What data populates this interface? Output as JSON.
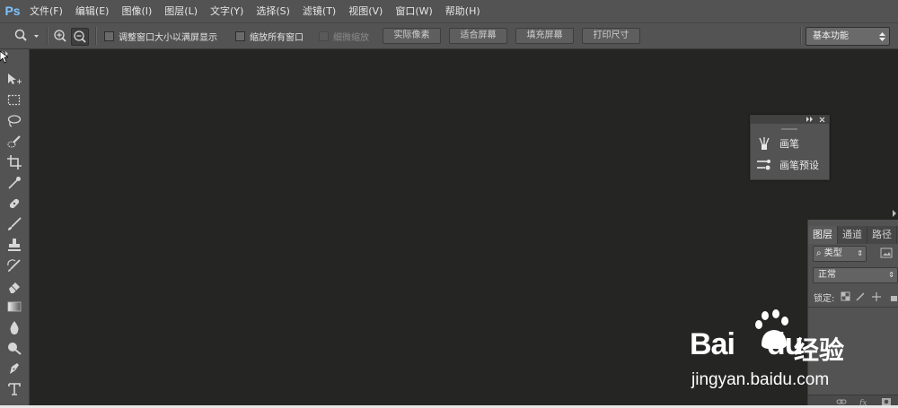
{
  "app": {
    "logo_text": "Ps"
  },
  "menu": [
    {
      "label": "文件(F)"
    },
    {
      "label": "编辑(E)"
    },
    {
      "label": "图像(I)"
    },
    {
      "label": "图层(L)"
    },
    {
      "label": "文字(Y)"
    },
    {
      "label": "选择(S)"
    },
    {
      "label": "滤镜(T)"
    },
    {
      "label": "视图(V)"
    },
    {
      "label": "窗口(W)"
    },
    {
      "label": "帮助(H)"
    }
  ],
  "options": {
    "resize_windows_label": "调整窗口大小以满屏显示",
    "zoom_all_windows_label": "缩放所有窗口",
    "scrubby_zoom_label": "细微缩放",
    "actual_pixels_label": "实际像素",
    "fit_screen_label": "适合屏幕",
    "fill_screen_label": "填充屏幕",
    "print_size_label": "打印尺寸",
    "workspace_label": "基本功能"
  },
  "brush_panel": {
    "items": [
      {
        "label": "画笔",
        "icon": "brush-icon"
      },
      {
        "label": "画笔预设",
        "icon": "brush-presets-icon"
      }
    ]
  },
  "layers_panel": {
    "tabs": [
      {
        "label": "图层",
        "active": true
      },
      {
        "label": "通道",
        "active": false
      },
      {
        "label": "路径",
        "active": false
      }
    ],
    "filter_kind": "类型",
    "blend_mode": "正常",
    "lock_label": "锁定:"
  },
  "watermark": {
    "brand": "Bai",
    "brand_tail": "du",
    "cn": "经验",
    "url": "jingyan.baidu.com"
  },
  "colors": {
    "ui_gray": "#535353",
    "canvas": "#252624",
    "ps_blue": "#7ec3ff"
  }
}
